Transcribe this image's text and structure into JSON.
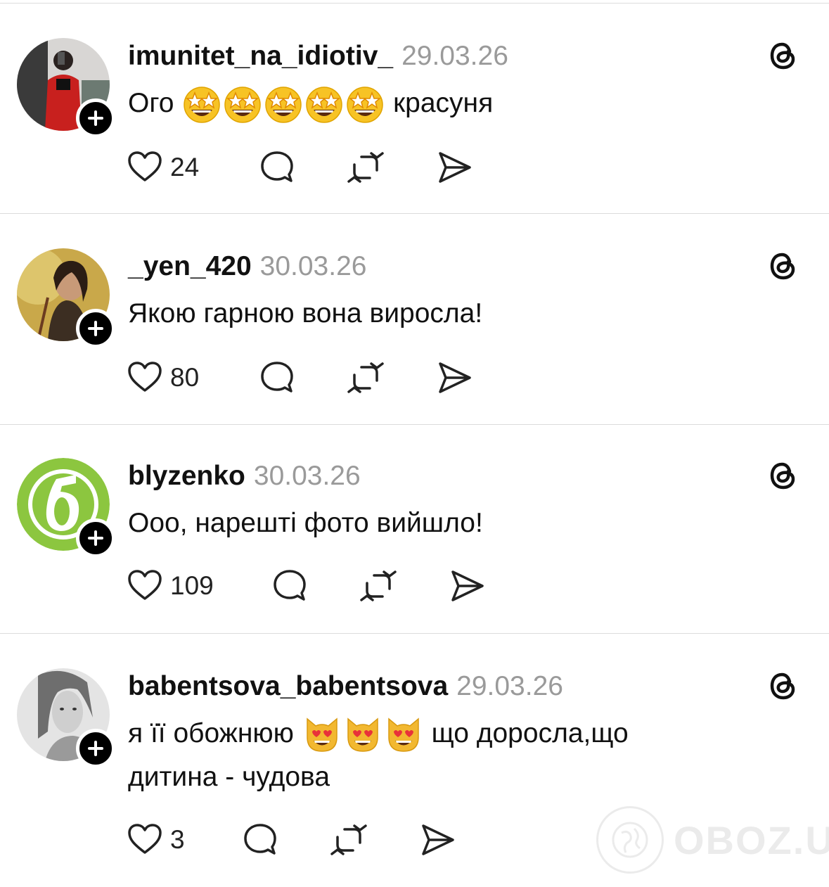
{
  "posts": [
    {
      "username": "imunitet_na_idiotiv_",
      "date": "29.03.26",
      "text_before": "Ого",
      "emoji_count": 5,
      "emoji": "star-struck",
      "text_after": "красуня",
      "likes": "24"
    },
    {
      "username": "_yen_420",
      "date": "30.03.26",
      "text": "Якою гарною вона виросла!",
      "likes": "80"
    },
    {
      "username": "blyzenko",
      "date": "30.03.26",
      "text": "Ооо, нарешті фото вийшло!",
      "likes": "109"
    },
    {
      "username": "babentsova_babentsova",
      "date": "29.03.26",
      "text_before": "я її обожнюю",
      "emoji_count": 3,
      "emoji": "heart-eyes-cat",
      "text_after": "що доросла,що",
      "text_line2": "дитина - чудова",
      "likes": "3"
    }
  ],
  "watermark": "OBOZ.UA",
  "colors": {
    "text": "#111111",
    "date": "#9a9a9a",
    "divider": "#dcdcdc",
    "blyzenko_green": "#8cc63f"
  }
}
